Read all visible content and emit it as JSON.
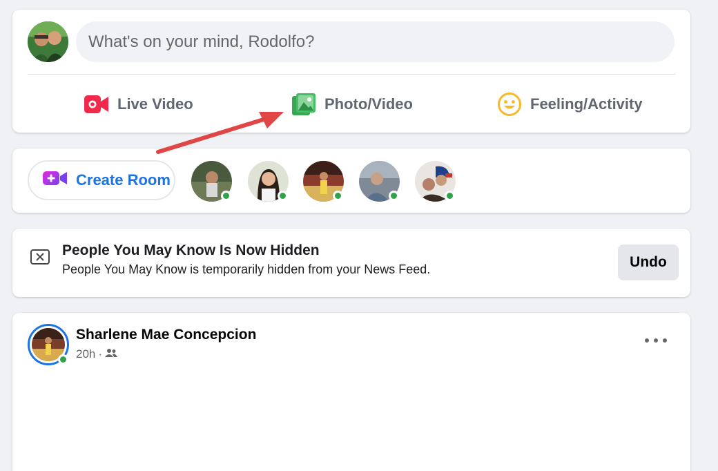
{
  "composer": {
    "placeholder": "What's on your mind, Rodolfo?",
    "actions": [
      {
        "label": "Live Video",
        "icon": "live-video-icon",
        "color": "#f02849"
      },
      {
        "label": "Photo/Video",
        "icon": "photo-video-icon",
        "color": "#45bd62"
      },
      {
        "label": "Feeling/Activity",
        "icon": "feeling-icon",
        "color": "#f7b928"
      }
    ]
  },
  "rooms": {
    "create_label": "Create Room",
    "create_icon_color": "#a334fa"
  },
  "pymk": {
    "title": "People You May Know Is Now Hidden",
    "subtitle": "People You May Know is temporarily hidden from your News Feed.",
    "undo_label": "Undo"
  },
  "post": {
    "author": "Sharlene Mae Concepcion",
    "time": "20h",
    "separator": "·",
    "audience_icon": "friends-icon"
  },
  "colors": {
    "accent": "#1b74e4",
    "online": "#31a24c",
    "annotation_arrow": "#e04646"
  }
}
